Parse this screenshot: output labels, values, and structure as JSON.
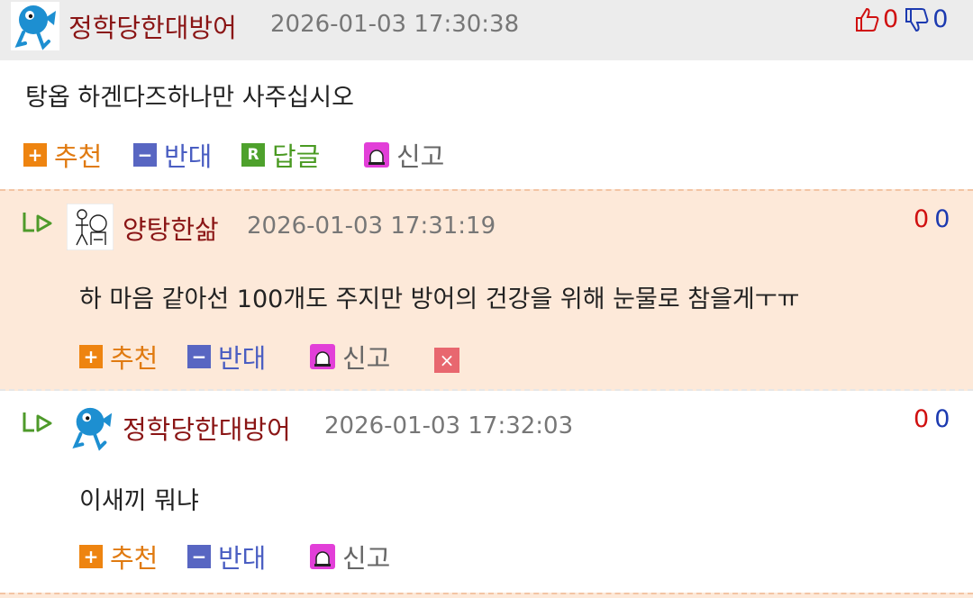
{
  "comments": [
    {
      "nickname": "정학당한대방어",
      "timestamp": "2026-01-03 17:30:38",
      "text": "탕옵 하겐다즈하나만 사주십시오",
      "up_count": "0",
      "down_count": "0",
      "actions": {
        "recommend": "추천",
        "oppose": "반대",
        "reply": "답글",
        "report": "신고"
      },
      "action_icons": {
        "recommend": "+",
        "oppose": "−",
        "reply": "R"
      }
    },
    {
      "nickname": "양탕한삶",
      "timestamp": "2026-01-03 17:31:19",
      "text": "하 마음 같아선 100개도 주지만 방어의 건강을 위해 눈물로 참을게ㅜㅠ",
      "up_count": "0",
      "down_count": "0",
      "actions": {
        "recommend": "추천",
        "oppose": "반대",
        "report": "신고",
        "delete": "×"
      },
      "action_icons": {
        "recommend": "+",
        "oppose": "−"
      }
    },
    {
      "nickname": "정학당한대방어",
      "timestamp": "2026-01-03 17:32:03",
      "text": "이새끼 뭐냐",
      "up_count": "0",
      "down_count": "0",
      "actions": {
        "recommend": "추천",
        "oppose": "반대",
        "report": "신고"
      },
      "action_icons": {
        "recommend": "+",
        "oppose": "−"
      }
    }
  ],
  "colors": {
    "header_bg": "#ececec",
    "reply_bg": "#fde9d9",
    "nickname": "#8a1515",
    "recommend": "#ee8410",
    "oppose": "#5866c2",
    "reply": "#4ea12c",
    "report": "#e23fd8",
    "upvote": "#d01010",
    "downvote": "#1c3ab0"
  },
  "icons": {
    "avatar_1": "blue-fish-avatar",
    "avatar_2": "sketch-figure-avatar",
    "thumbs_up": "thumbs-up-icon",
    "thumbs_down": "thumbs-down-icon",
    "reply_indicator": "reply-arrow-icon",
    "report": "siren-icon",
    "delete": "close-icon"
  }
}
